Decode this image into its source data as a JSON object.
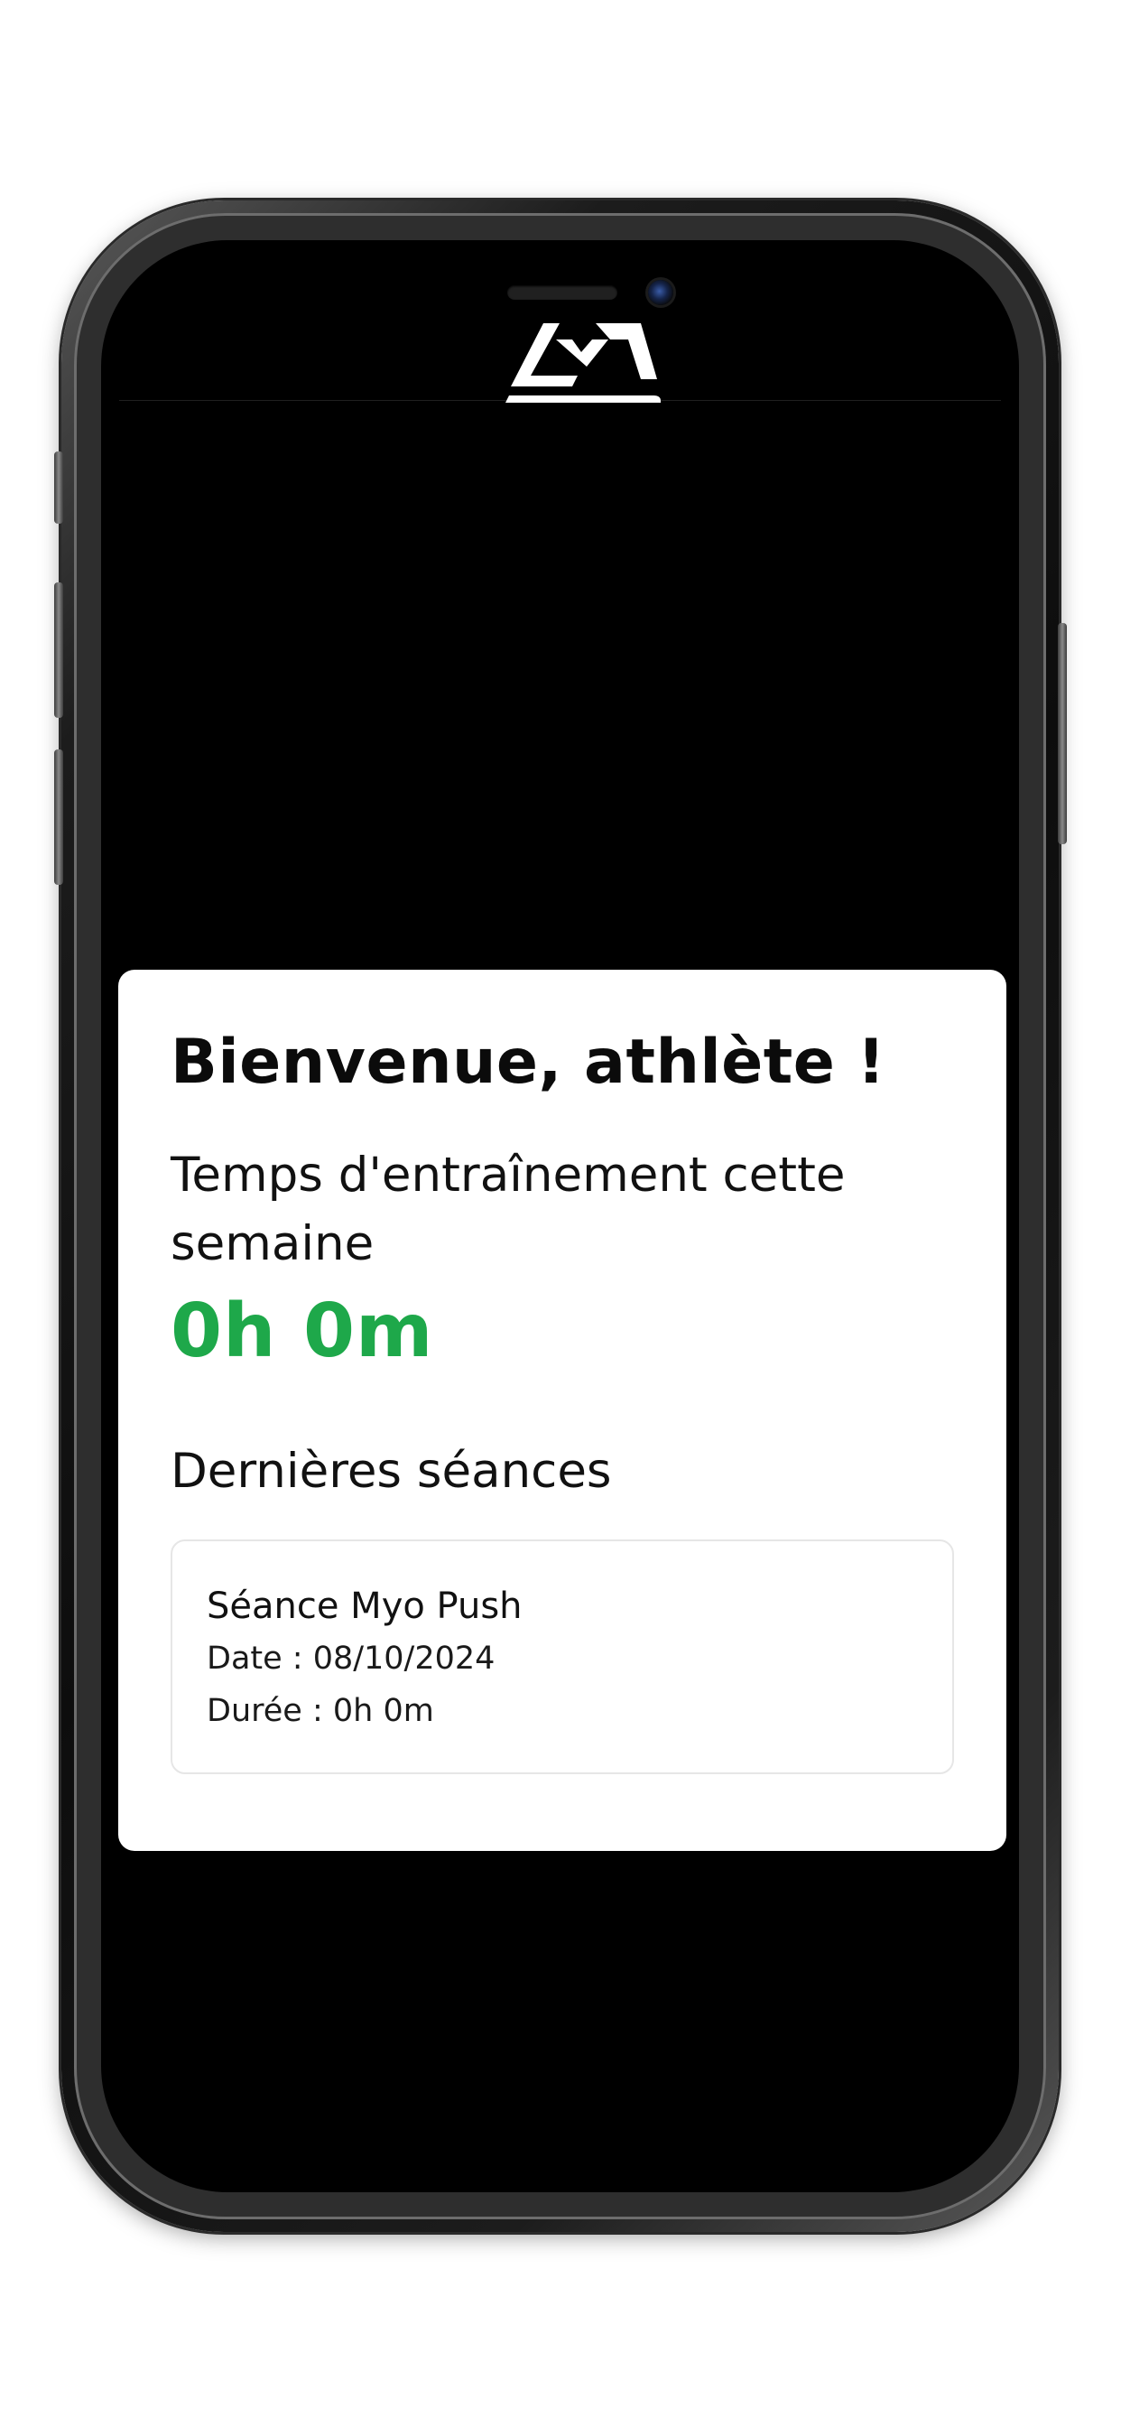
{
  "colors": {
    "accent_green": "#1ea84a",
    "screen_background": "#000000",
    "card_background": "#ffffff"
  },
  "header": {
    "logo_icon": "brand-logo-icon"
  },
  "welcome": {
    "title": "Bienvenue, athlète !",
    "training_time_label": "Temps d'entraînement cette semaine",
    "training_time_value": "0h 0m",
    "recent_sessions_label": "Dernières séances"
  },
  "sessions": [
    {
      "name": "Séance Myo Push",
      "date_line": "Date : 08/10/2024",
      "duration_line": "Durée : 0h 0m"
    }
  ]
}
